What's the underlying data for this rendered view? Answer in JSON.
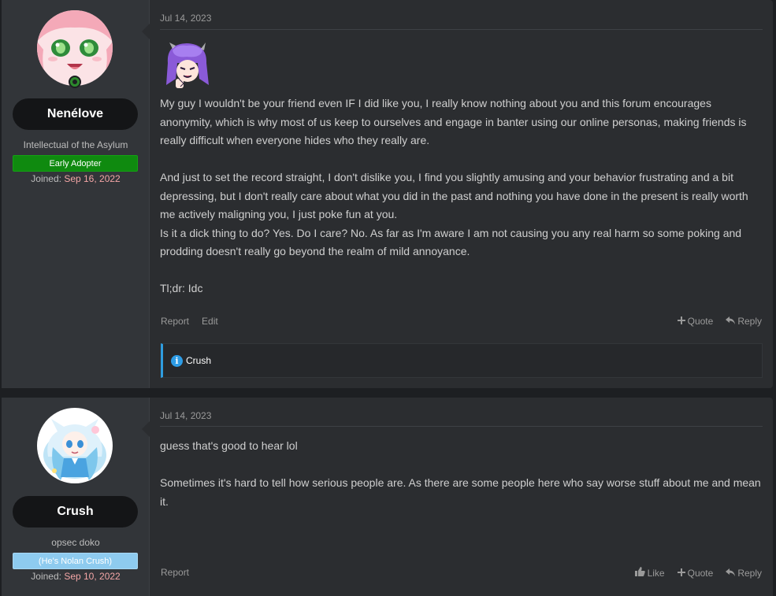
{
  "posts": [
    {
      "user": {
        "name": "Nenélove",
        "title": "Intellectual of the Asylum",
        "banner": "Early Adopter",
        "joined_label": "Joined:",
        "joined_date": "Sep 16, 2022"
      },
      "date": "Jul 14, 2023",
      "paragraphs": [
        "My guy I wouldn't be your friend even IF I did like you, I really know nothing about you and this forum encourages anonymity, which is why most of us keep to ourselves and engage in banter using our online personas, making friends is really difficult when everyone hides who they really are.",
        "And just to set the record straight, I don't dislike you, I find you slightly amusing and your behavior frustrating and a bit depressing, but I don't really care about what you did in the past and nothing you have done in the present is really worth me actively maligning you, I just poke fun at you.",
        "Is it a dick thing to do? Yes. Do I care? No. As far as I'm aware I am not causing you any real harm so some poking and prodding doesn't really go beyond the realm of mild annoyance.",
        "Tl;dr: Idc"
      ],
      "actions": {
        "report": "Report",
        "edit": "Edit",
        "quote": "Quote",
        "reply": "Reply"
      },
      "reaction_user": "Crush"
    },
    {
      "user": {
        "name": "Crush",
        "title": "opsec doko",
        "banner": "(He's Nolan Crush)",
        "joined_label": "Joined:",
        "joined_date": "Sep 10, 2022"
      },
      "date": "Jul 14, 2023",
      "paragraphs": [
        "guess that's good to hear lol",
        "Sometimes it's hard to tell how serious people are. As there are some people here who say worse stuff about me and mean it."
      ],
      "actions": {
        "report": "Report",
        "like": "Like",
        "quote": "Quote",
        "reply": "Reply"
      }
    }
  ],
  "icons": {
    "quote": "plus-icon",
    "reply": "reply-arrow-icon",
    "like": "thumbs-up-icon",
    "info": "info-icon",
    "online": "online-status-icon"
  },
  "colors": {
    "early_adopter": "#0f8a0f",
    "nolan_banner": "#8ecbef",
    "joined_date": "#f4a6a6",
    "reaction_accent": "#2f9de0"
  }
}
